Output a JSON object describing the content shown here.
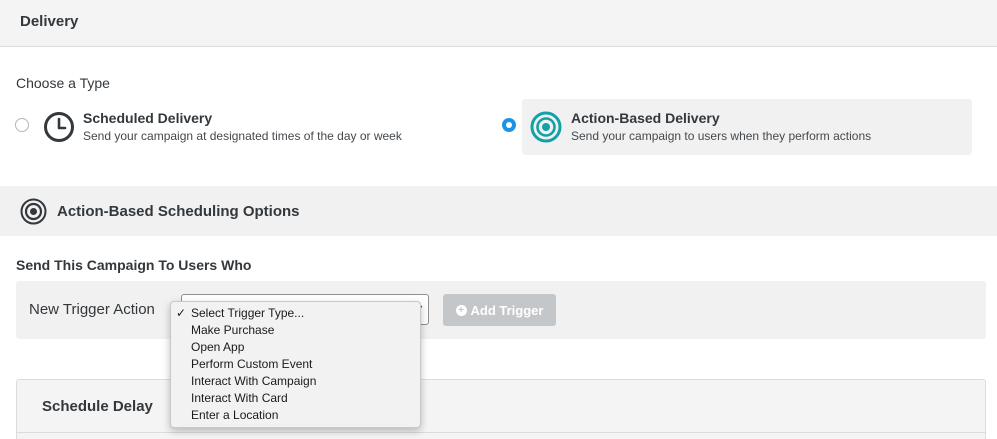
{
  "header": {
    "title": "Delivery"
  },
  "choose_type": {
    "label": "Choose a Type",
    "options": [
      {
        "title": "Scheduled Delivery",
        "description": "Send your campaign at designated times of the day or week",
        "icon": "clock-icon",
        "selected": false
      },
      {
        "title": "Action-Based Delivery",
        "description": "Send your campaign to users when they perform actions",
        "icon": "target-icon",
        "selected": true
      }
    ]
  },
  "section": {
    "title": "Action-Based Scheduling Options",
    "icon": "target-icon"
  },
  "send_to": {
    "label": "Send This Campaign To Users Who"
  },
  "trigger": {
    "label": "New Trigger Action",
    "add_button_label": "Add Trigger",
    "add_button_icon": "plus-circle-icon",
    "dropdown": {
      "checkmark": "✓",
      "options": [
        "Select Trigger Type...",
        "Make Purchase",
        "Open App",
        "Perform Custom Event",
        "Interact With Campaign",
        "Interact With Card",
        "Enter a Location"
      ]
    }
  },
  "schedule_delay": {
    "title": "Schedule Delay"
  },
  "colors": {
    "accent": "#1e93e6",
    "teal": "#12a1a8",
    "dark": "#33383c"
  }
}
